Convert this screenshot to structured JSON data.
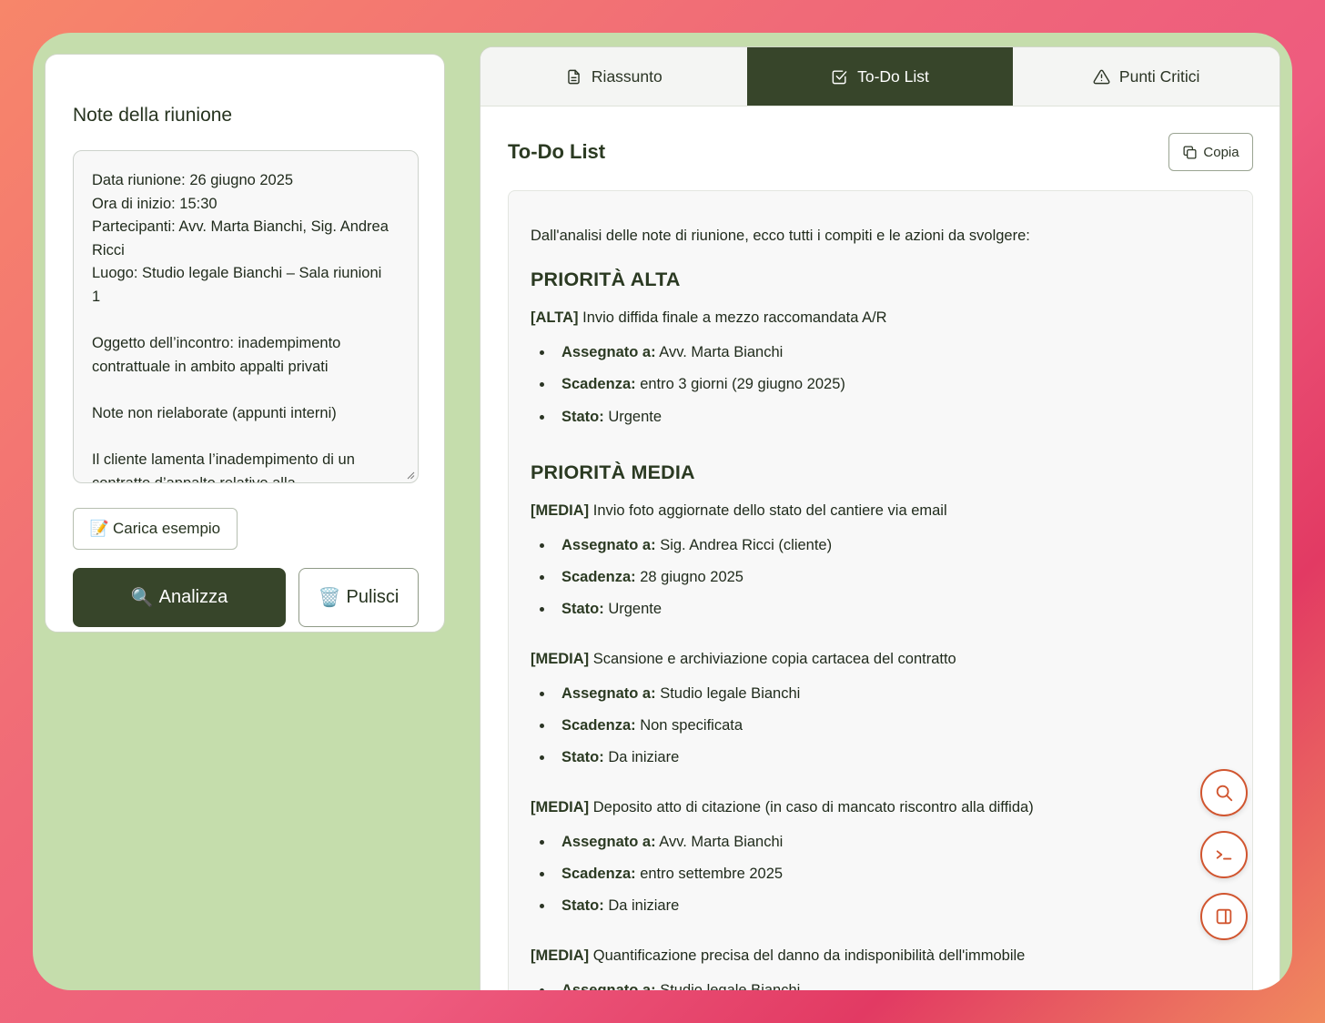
{
  "left": {
    "title": "Note della riunione",
    "notes_lines": [
      "Data riunione: 26 giugno 2025",
      "Ora di inizio: 15:30",
      "Partecipanti: Avv. Marta Bianchi, Sig. Andrea",
      "Ricci",
      "Luogo: Studio legale Bianchi – Sala riunioni",
      "1",
      "",
      "Oggetto dell’incontro: inadempimento",
      "contrattuale in ambito appalti privati",
      "",
      "Note non rielaborate (appunti interni)",
      "",
      "Il cliente lamenta l’inadempimento di un",
      "contratto d’appalto relativo alla"
    ],
    "example_button": {
      "icon": "📝",
      "label": "Carica esempio"
    },
    "analyze_button": {
      "icon": "🔍",
      "label": "Analizza"
    },
    "clear_button": {
      "icon": "🗑️",
      "label": "Pulisci"
    }
  },
  "tabs": [
    {
      "label": "Riassunto",
      "icon": "document-icon",
      "active": false
    },
    {
      "label": "To-Do List",
      "icon": "checkbox-icon",
      "active": true
    },
    {
      "label": "Punti Critici",
      "icon": "warning-icon",
      "active": false
    }
  ],
  "content": {
    "title": "To-Do List",
    "copy_label": "Copia",
    "intro": "Dall'analisi delle note di riunione, ecco tutti i compiti e le azioni da svolgere:",
    "groups": [
      {
        "heading": "PRIORITÀ ALTA",
        "tasks": [
          {
            "tag": "[ALTA]",
            "text": " Invio diffida finale a mezzo raccomandata A/R",
            "details": [
              {
                "key": "Assegnato a:",
                "value": " Avv. Marta Bianchi"
              },
              {
                "key": "Scadenza:",
                "value": " entro 3 giorni (29 giugno 2025)"
              },
              {
                "key": "Stato:",
                "value": " Urgente"
              }
            ]
          }
        ]
      },
      {
        "heading": "PRIORITÀ MEDIA",
        "tasks": [
          {
            "tag": "[MEDIA]",
            "text": " Invio foto aggiornate dello stato del cantiere via email",
            "details": [
              {
                "key": "Assegnato a:",
                "value": " Sig. Andrea Ricci (cliente)"
              },
              {
                "key": "Scadenza:",
                "value": " 28 giugno 2025"
              },
              {
                "key": "Stato:",
                "value": " Urgente"
              }
            ]
          },
          {
            "tag": "[MEDIA]",
            "text": " Scansione e archiviazione copia cartacea del contratto",
            "details": [
              {
                "key": "Assegnato a:",
                "value": " Studio legale Bianchi"
              },
              {
                "key": "Scadenza:",
                "value": " Non specificata"
              },
              {
                "key": "Stato:",
                "value": " Da iniziare"
              }
            ]
          },
          {
            "tag": "[MEDIA]",
            "text": " Deposito atto di citazione (in caso di mancato riscontro alla diffida)",
            "details": [
              {
                "key": "Assegnato a:",
                "value": " Avv. Marta Bianchi"
              },
              {
                "key": "Scadenza:",
                "value": " entro settembre 2025"
              },
              {
                "key": "Stato:",
                "value": " Da iniziare"
              }
            ]
          },
          {
            "tag": "[MEDIA]",
            "text": " Quantificazione precisa del danno da indisponibilità dell'immobile",
            "details": [
              {
                "key": "Assegnato a:",
                "value": " Studio legale Bianchi"
              }
            ]
          }
        ]
      }
    ]
  },
  "floating_buttons": [
    "search-icon",
    "terminal-icon",
    "sidebar-panel-icon"
  ],
  "colors": {
    "accent_dark_green": "#37452a",
    "window_bg": "#c5ddac",
    "fab_border": "#d1552f"
  }
}
